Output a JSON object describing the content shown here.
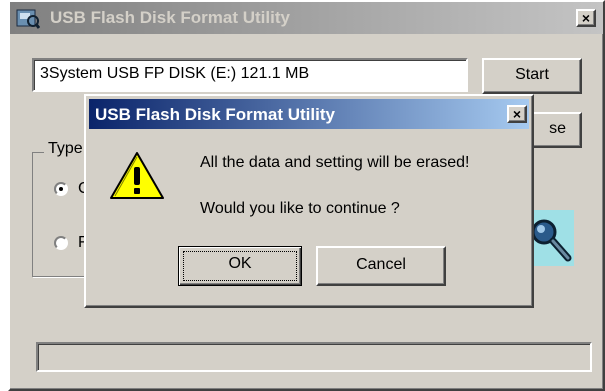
{
  "main_window": {
    "title": "USB Flash Disk Format Utility",
    "close_label": "×",
    "device_field": "3System USB FP DISK (E:)  121.1 MB",
    "start_label": "Start",
    "close_button_partial": "se",
    "type_group_label": "Type",
    "radio_options": [
      {
        "label": "C",
        "selected": true
      },
      {
        "label": "F",
        "selected": false
      }
    ]
  },
  "dialog": {
    "title": "USB Flash Disk Format Utility",
    "close_label": "×",
    "icon": "warning-icon",
    "message_line1": "All the data and setting will be erased!",
    "message_line2": "Would you like to continue ?",
    "ok_label": "OK",
    "cancel_label": "Cancel"
  },
  "colors": {
    "face": "#d4d0c8",
    "active_title": "#0a246a",
    "inactive_title": "#808080",
    "warning_yellow": "#ffff00"
  }
}
